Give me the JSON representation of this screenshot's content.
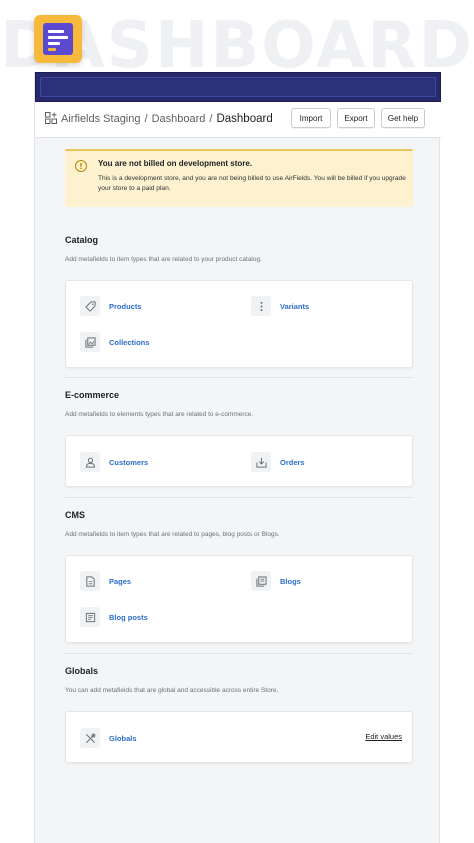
{
  "watermark": "DASHBOARD",
  "header": {
    "breadcrumb_root": "Airfields Staging",
    "breadcrumb_sep1": "/",
    "breadcrumb_middle": "Dashboard",
    "breadcrumb_sep2": "/",
    "breadcrumb_current": "Dashboard",
    "import_label": "Import",
    "export_label": "Export",
    "help_label": "Get help"
  },
  "banner": {
    "icon_glyph": "!",
    "title": "You are not billed on development store.",
    "text": "This is a development store, and you are not being billed to use AirFields. You will be billed if you upgrade your store to a paid plan."
  },
  "sections": {
    "catalog": {
      "title": "Catalog",
      "description": "Add metafields to item types that are related to your product catalog.",
      "items": [
        {
          "label": "Products",
          "icon": "tag-icon"
        },
        {
          "label": "Variants",
          "icon": "more-vertical-icon"
        },
        {
          "label": "Collections",
          "icon": "collections-icon"
        }
      ]
    },
    "ecommerce": {
      "title": "E-commerce",
      "description": "Add metafields to elements types that are related to e-commerce.",
      "items": [
        {
          "label": "Customers",
          "icon": "customer-icon"
        },
        {
          "label": "Orders",
          "icon": "orders-icon"
        }
      ]
    },
    "cms": {
      "title": "CMS",
      "description": "Add metafields to item types that are related to pages, blog posts or Blogs.",
      "items": [
        {
          "label": "Pages",
          "icon": "page-icon"
        },
        {
          "label": "Blogs",
          "icon": "blog-icon"
        },
        {
          "label": "Blog posts",
          "icon": "blog-post-icon"
        }
      ]
    },
    "globals": {
      "title": "Globals",
      "description": "You can add metafields that are global and accessible across entire Store.",
      "items": [
        {
          "label": "Globals",
          "icon": "tools-icon"
        }
      ],
      "edit_label": "Edit values"
    }
  },
  "colors": {
    "topbar": "#262a6b",
    "link": "#2c6ecb",
    "banner_bg": "#fdf1cf",
    "banner_accent": "#e8c75a",
    "logo_bg": "#f6b93b",
    "logo_doc": "#5b4ad0"
  }
}
